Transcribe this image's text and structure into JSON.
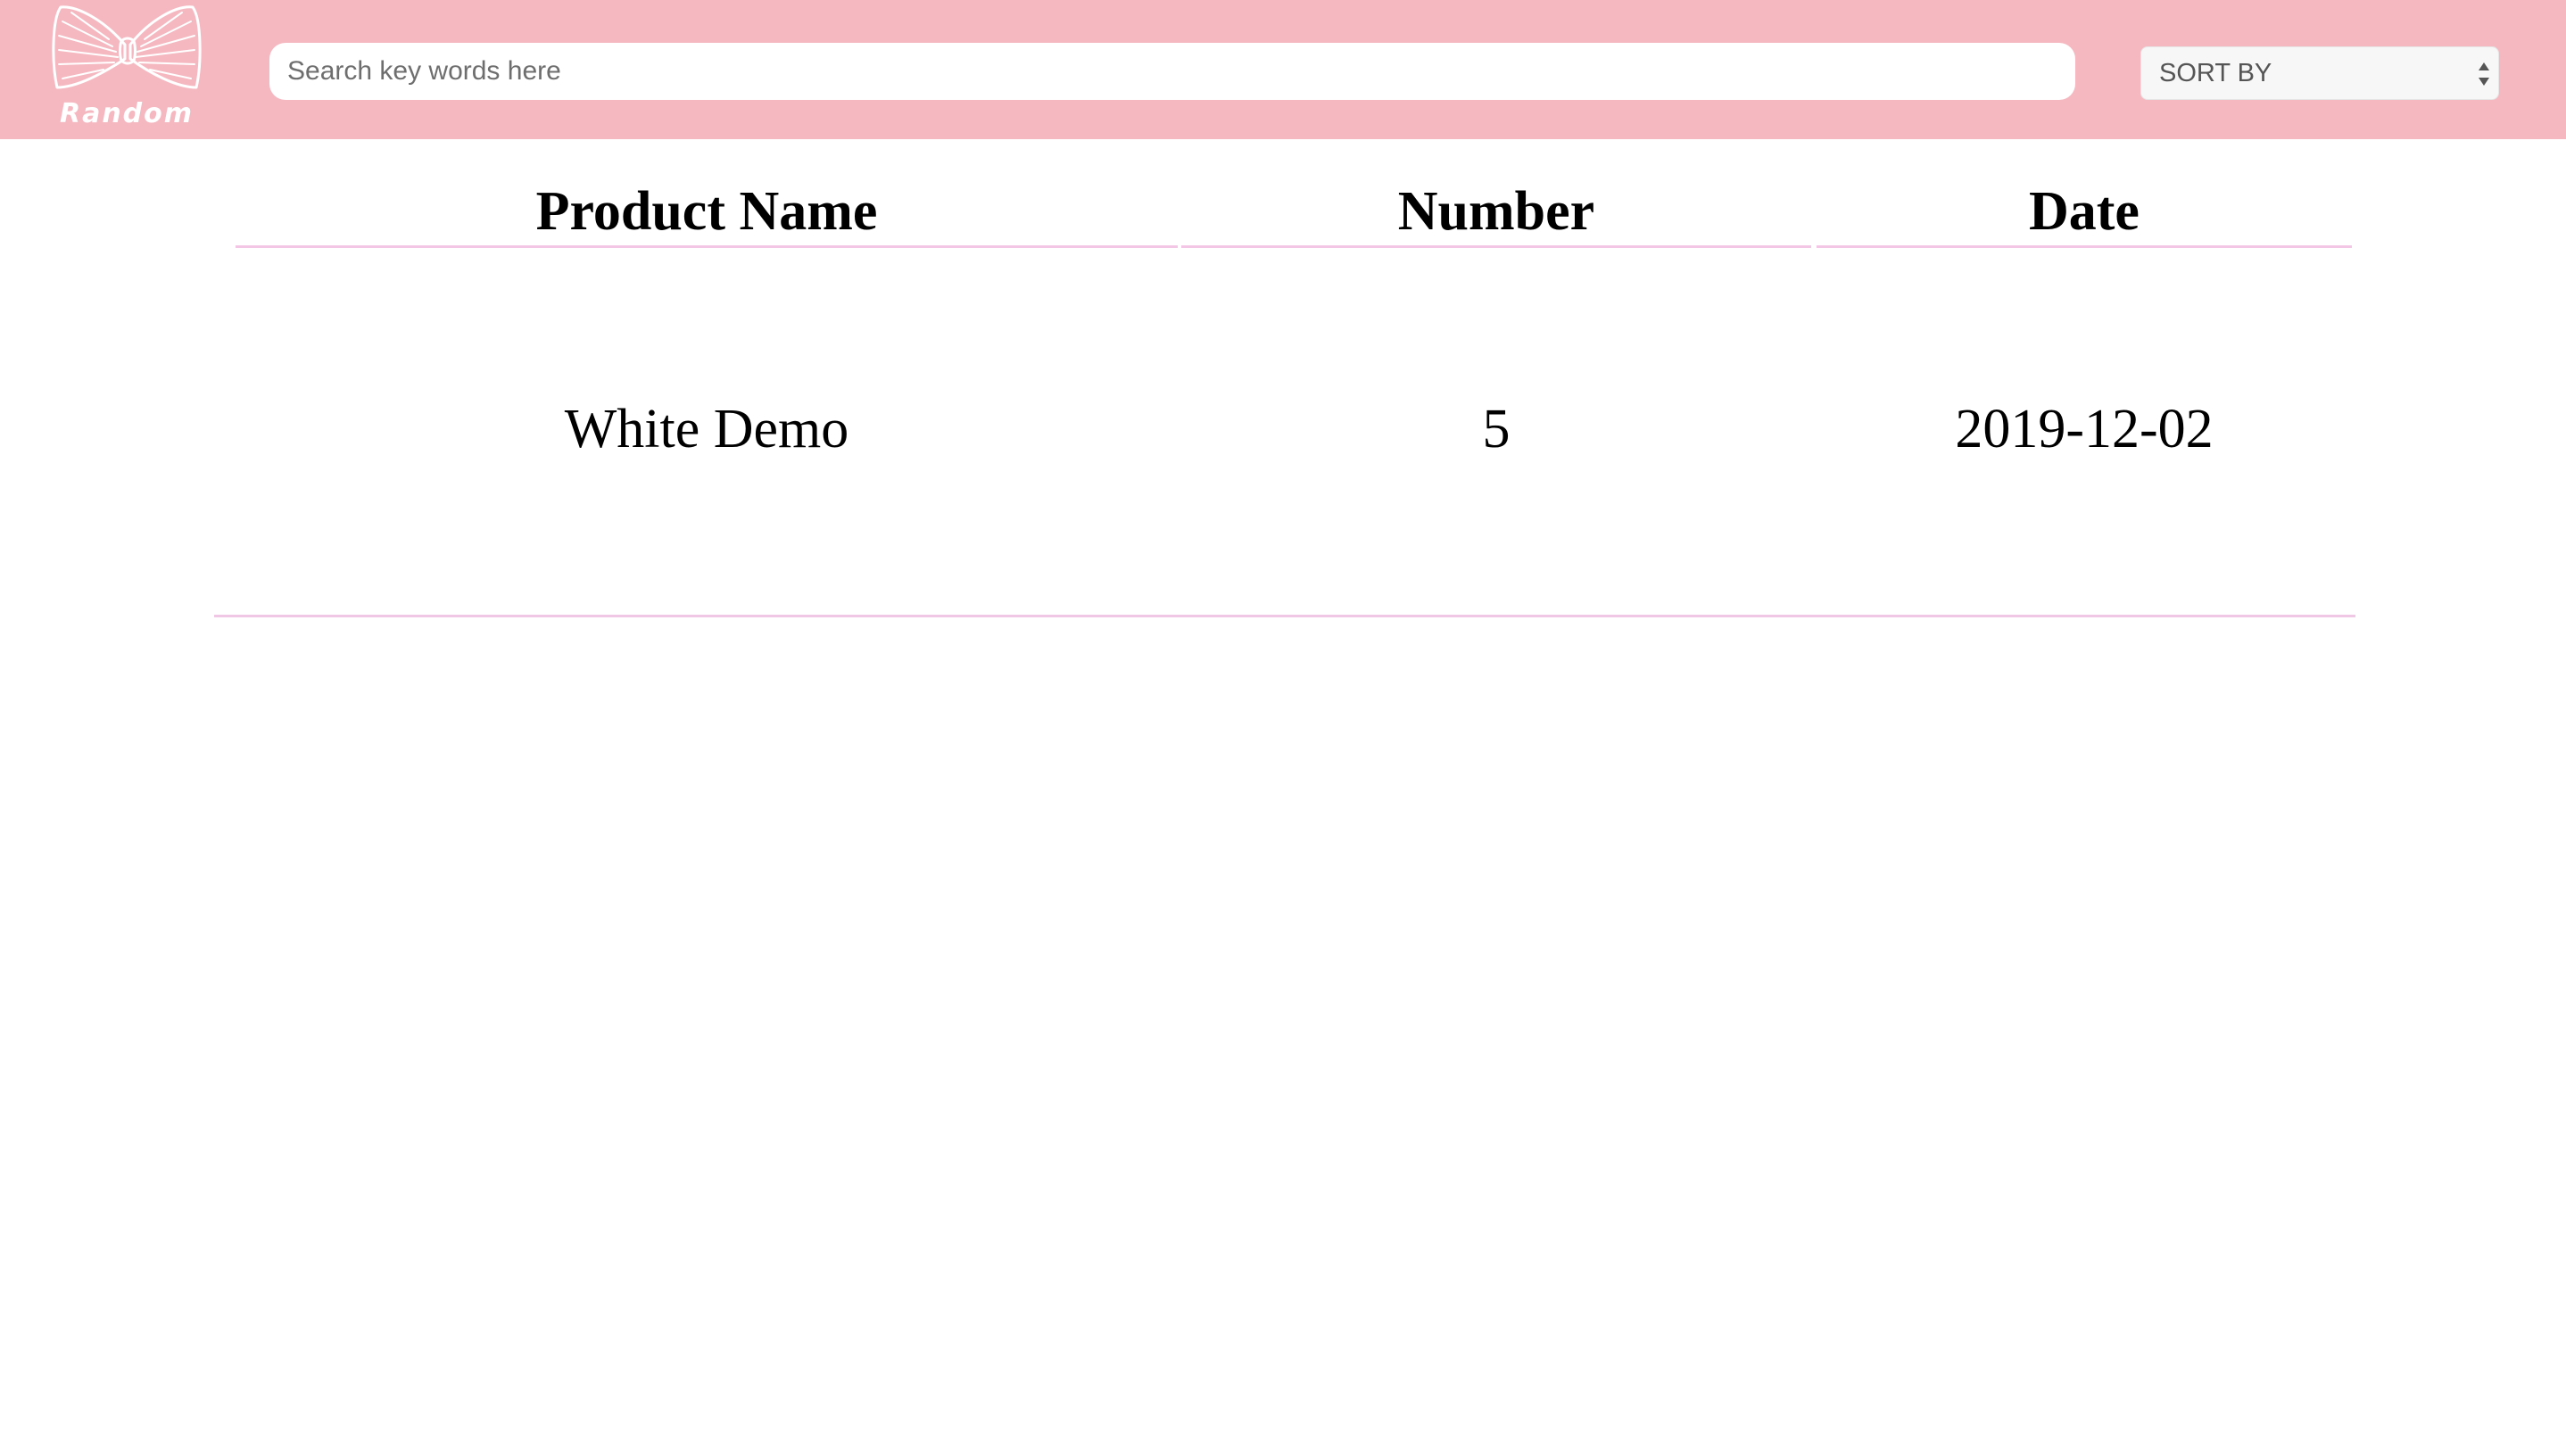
{
  "header": {
    "logo_text": "Random",
    "search": {
      "placeholder": "Search key words here",
      "value": ""
    },
    "sort": {
      "label": "SORT BY"
    }
  },
  "table": {
    "columns": [
      "Product Name",
      "Number",
      "Date"
    ],
    "rows": [
      [
        "White Demo",
        "5",
        "2019-12-02"
      ]
    ]
  },
  "colors": {
    "header_bg": "#f5b8c1",
    "divider": "#f2c6e4"
  },
  "icons": {
    "logo": "bow-tie-icon",
    "sort": "sort-arrows-icon"
  }
}
